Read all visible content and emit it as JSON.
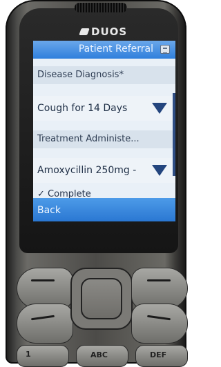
{
  "device": {
    "brand": "DUOS"
  },
  "screen": {
    "title": "Patient Referral",
    "fields": [
      {
        "label": "Disease Diagnosis*",
        "value": "Cough for 14 Days"
      },
      {
        "label": "Treatment Administe...",
        "value": "Amoxycillin 250mg -"
      }
    ],
    "checkbox_label": "Complete",
    "softkey_left": "Back"
  },
  "keypad": {
    "key_1": "1",
    "key_abc": "ABC",
    "key_def": "DEF"
  },
  "colors": {
    "titlebar": "#2f7fdc",
    "softbar": "#2a77d2",
    "caret": "#23457e"
  }
}
